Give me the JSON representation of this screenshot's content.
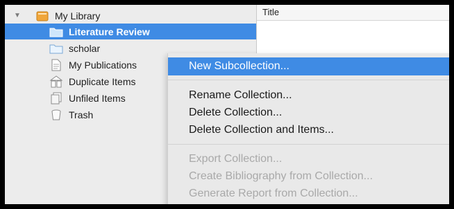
{
  "sidebar": {
    "library": {
      "label": "My Library",
      "expanded": true
    },
    "items": [
      {
        "label": "Literature Review",
        "icon": "folder-icon",
        "selected": true
      },
      {
        "label": "scholar",
        "icon": "folder-icon"
      },
      {
        "label": "My Publications",
        "icon": "document-icon"
      },
      {
        "label": "Duplicate Items",
        "icon": "duplicate-items-icon"
      },
      {
        "label": "Unfiled Items",
        "icon": "unfiled-items-icon"
      },
      {
        "label": "Trash",
        "icon": "trash-icon"
      }
    ]
  },
  "items_pane": {
    "column_header": "Title"
  },
  "context_menu": {
    "new_subcollection": "New Subcollection...",
    "rename_collection": "Rename Collection...",
    "delete_collection": "Delete Collection...",
    "delete_collection_and_items": "Delete Collection and Items...",
    "export_collection": "Export Collection...",
    "create_bibliography": "Create Bibliography from Collection...",
    "generate_report": "Generate Report from Collection..."
  },
  "colors": {
    "selection": "#3f8be4",
    "library_icon": "#f0a63a",
    "folder_icon": "#9cc8ee",
    "disabled_text": "#a9a9a9"
  }
}
